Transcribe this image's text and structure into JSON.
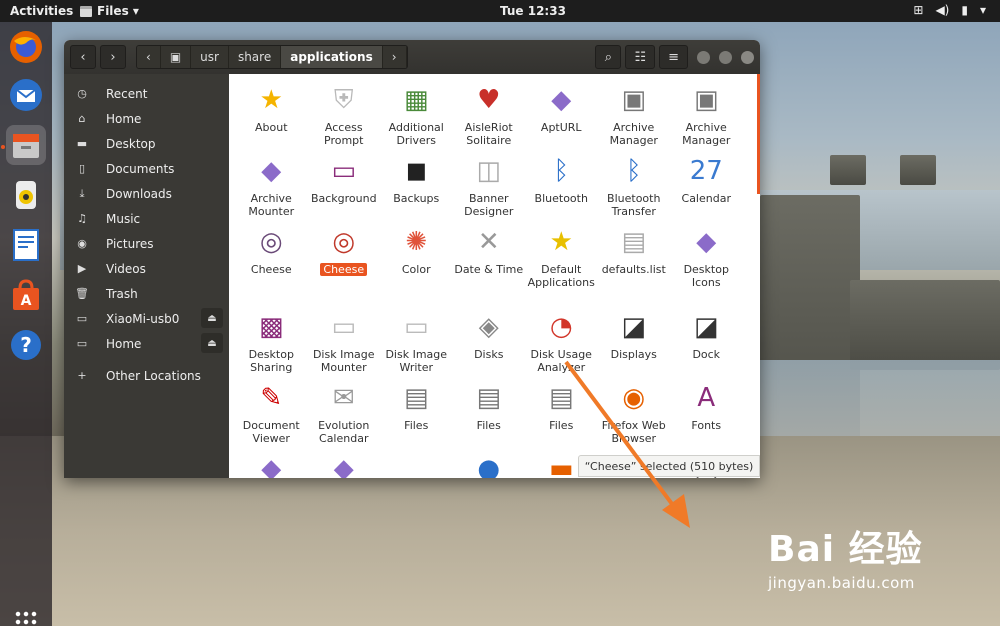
{
  "topbar": {
    "activities": "Activities",
    "app_menu": "Files ▾",
    "clock": "Tue 12:33",
    "tray": [
      "network-icon",
      "volume-icon",
      "battery-icon",
      "menu-icon"
    ]
  },
  "dock": [
    "firefox",
    "thunderbird",
    "files",
    "rhythmbox",
    "writer",
    "software",
    "help"
  ],
  "window": {
    "nav_back": "‹",
    "nav_forward": "›",
    "path_left": "‹",
    "path": [
      "usr",
      "share",
      "applications"
    ],
    "path_right": "›",
    "search_icon": "⌕",
    "view_icon": "☷",
    "menu_icon": "≡"
  },
  "sidebar": {
    "places": [
      {
        "icon": "clock-icon",
        "glyph": "◷",
        "label": "Recent"
      },
      {
        "icon": "home-icon",
        "glyph": "⌂",
        "label": "Home"
      },
      {
        "icon": "folder-icon",
        "glyph": "▬",
        "label": "Desktop"
      },
      {
        "icon": "document-icon",
        "glyph": "▯",
        "label": "Documents"
      },
      {
        "icon": "download-icon",
        "glyph": "⤓",
        "label": "Downloads"
      },
      {
        "icon": "music-icon",
        "glyph": "♫",
        "label": "Music"
      },
      {
        "icon": "camera-icon",
        "glyph": "◉",
        "label": "Pictures"
      },
      {
        "icon": "video-icon",
        "glyph": "▶",
        "label": "Videos"
      },
      {
        "icon": "trash-icon",
        "glyph": "🗑",
        "label": "Trash"
      },
      {
        "icon": "drive-icon",
        "glyph": "▭",
        "label": "XiaoMi-usb0",
        "eject": "⏏"
      },
      {
        "icon": "drive-icon",
        "glyph": "▭",
        "label": "Home",
        "eject": "⏏"
      }
    ],
    "other": {
      "icon": "plus-icon",
      "glyph": "+",
      "label": "Other Locations"
    }
  },
  "apps": [
    {
      "label": "About",
      "glyph": "★",
      "color": "#f5b400"
    },
    {
      "label": "Access Prompt",
      "glyph": "⛨",
      "color": "#b9b9b9"
    },
    {
      "label": "Additional Drivers",
      "glyph": "▦",
      "color": "#4a8a3a"
    },
    {
      "label": "AisleRiot Solitaire",
      "glyph": "♥",
      "color": "#c8302a"
    },
    {
      "label": "AptURL",
      "glyph": "◆",
      "color": "#8b6bc9"
    },
    {
      "label": "Archive Manager",
      "glyph": "▣",
      "color": "#777"
    },
    {
      "label": "Archive Manager",
      "glyph": "▣",
      "color": "#777"
    },
    {
      "label": "Archive Mounter",
      "glyph": "◆",
      "color": "#8b6bc9"
    },
    {
      "label": "Background",
      "glyph": "▭",
      "color": "#8a2c7a"
    },
    {
      "label": "Backups",
      "glyph": "◼",
      "color": "#222"
    },
    {
      "label": "Banner Designer",
      "glyph": "◫",
      "color": "#aaa"
    },
    {
      "label": "Bluetooth",
      "glyph": "ᛒ",
      "color": "#2a6fc9"
    },
    {
      "label": "Bluetooth Transfer",
      "glyph": "ᛒ",
      "color": "#2a6fc9"
    },
    {
      "label": "Calendar",
      "glyph": "27",
      "color": "#3a7ad0"
    },
    {
      "label": "Cheese",
      "glyph": "◎",
      "color": "#6a4a78"
    },
    {
      "label": "Cheese",
      "glyph": "◎",
      "color": "#c0392b",
      "selected": true
    },
    {
      "label": "Color",
      "glyph": "✺",
      "color": "#e0533a"
    },
    {
      "label": "Date & Time",
      "glyph": "✕",
      "color": "#999"
    },
    {
      "label": "Default Applications",
      "glyph": "★",
      "color": "#e8c000"
    },
    {
      "label": "defaults.list",
      "glyph": "▤",
      "color": "#aaa"
    },
    {
      "label": "Desktop Icons",
      "glyph": "◆",
      "color": "#8b6bc9"
    },
    {
      "label": "Desktop Sharing",
      "glyph": "▩",
      "color": "#8a2c7a"
    },
    {
      "label": "Disk Image Mounter",
      "glyph": "▭",
      "color": "#bbb"
    },
    {
      "label": "Disk Image Writer",
      "glyph": "▭",
      "color": "#bbb"
    },
    {
      "label": "Disks",
      "glyph": "◈",
      "color": "#888"
    },
    {
      "label": "Disk Usage Analyzer",
      "glyph": "◔",
      "color": "#d2362a"
    },
    {
      "label": "Displays",
      "glyph": "◪",
      "color": "#333"
    },
    {
      "label": "Dock",
      "glyph": "◪",
      "color": "#333"
    },
    {
      "label": "Document Viewer",
      "glyph": "✎",
      "color": "#c00"
    },
    {
      "label": "Evolution Calendar",
      "glyph": "✉",
      "color": "#999"
    },
    {
      "label": "Files",
      "glyph": "▤",
      "color": "#777"
    },
    {
      "label": "Files",
      "glyph": "▤",
      "color": "#777"
    },
    {
      "label": "Files",
      "glyph": "▤",
      "color": "#777"
    },
    {
      "label": "Firefox Web Browser",
      "glyph": "◉",
      "color": "#e66000"
    },
    {
      "label": "Fonts",
      "glyph": "A",
      "color": "#8a2c7a"
    },
    {
      "label": "",
      "glyph": "◆",
      "color": "#8b6bc9"
    },
    {
      "label": "",
      "glyph": "◆",
      "color": "#8b6bc9"
    },
    {
      "label": "",
      "glyph": "",
      "color": "#fff"
    },
    {
      "label": "",
      "glyph": "●",
      "color": "#2a6fc9"
    },
    {
      "label": "",
      "glyph": "▬",
      "color": "#e66000"
    },
    {
      "label": "",
      "glyph": "",
      "color": "#fff"
    },
    {
      "label": "",
      "glyph": "▢",
      "color": "#666"
    }
  ],
  "status": "“Cheese” selected  (510 bytes)",
  "watermark": {
    "brand": "Bai  经验",
    "url": "jingyan.baidu.com"
  },
  "colors": {
    "accent": "#e95420",
    "arrow": "#f07a28"
  }
}
